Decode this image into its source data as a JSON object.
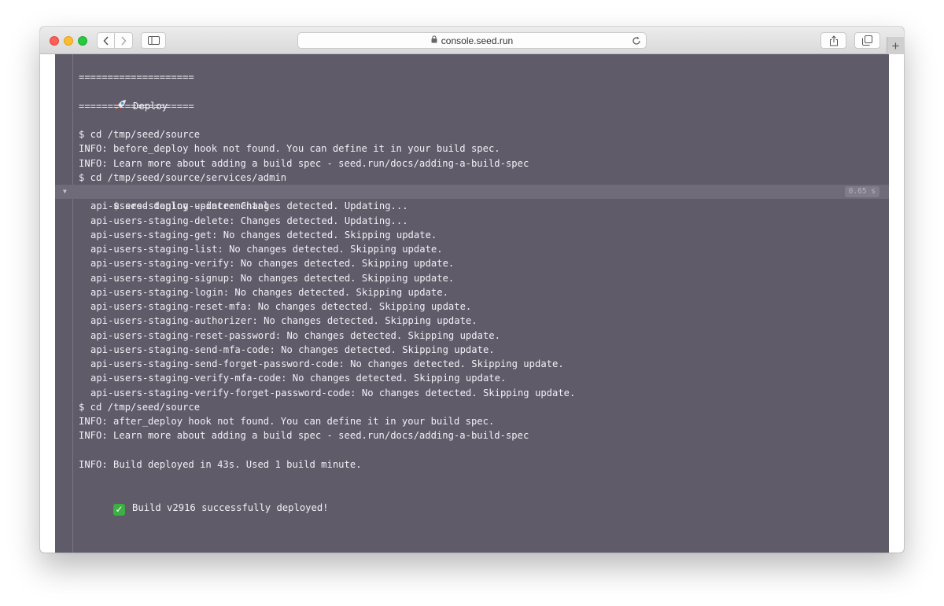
{
  "browser": {
    "url": "console.seed.run",
    "back_icon": "chevron-left-icon",
    "forward_icon": "chevron-right-icon",
    "sidebar_icon": "sidebar-icon",
    "share_icon": "share-icon",
    "tabs_icon": "tabs-icon",
    "reload_icon": "reload-icon",
    "lock_icon": "lock-icon",
    "newtab_label": "+"
  },
  "log": {
    "deploy_header": {
      "rule": "====================",
      "title": "Deploy",
      "icon": "rocket-icon"
    },
    "pre_lines": [
      "$ cd /tmp/seed/source",
      "INFO: before_deploy hook not found. You can define it in your build spec.",
      "INFO: Learn more about adding a build spec - seed.run/docs/adding-a-build-spec",
      "$ cd /tmp/seed/source/services/admin"
    ],
    "command": {
      "text": "$ seed deploy --incremental",
      "duration": "0.65 s",
      "caret_icon": "caret-down-icon"
    },
    "output_lines": [
      "api-users-staging-update: Changes detected. Updating...",
      "api-users-staging-delete: Changes detected. Updating...",
      "api-users-staging-get: No changes detected. Skipping update.",
      "api-users-staging-list: No changes detected. Skipping update.",
      "api-users-staging-verify: No changes detected. Skipping update.",
      "api-users-staging-signup: No changes detected. Skipping update.",
      "api-users-staging-login: No changes detected. Skipping update.",
      "api-users-staging-reset-mfa: No changes detected. Skipping update.",
      "api-users-staging-authorizer: No changes detected. Skipping update.",
      "api-users-staging-reset-password: No changes detected. Skipping update.",
      "api-users-staging-send-mfa-code: No changes detected. Skipping update.",
      "api-users-staging-send-forget-password-code: No changes detected. Skipping update.",
      "api-users-staging-verify-mfa-code: No changes detected. Skipping update.",
      "api-users-staging-verify-forget-password-code: No changes detected. Skipping update."
    ],
    "post_lines": [
      "$ cd /tmp/seed/source",
      "INFO: after_deploy hook not found. You can define it in your build spec.",
      "INFO: Learn more about adding a build spec - seed.run/docs/adding-a-build-spec"
    ],
    "summary": "INFO: Build deployed in 43s. Used 1 build minute.",
    "success": {
      "icon": "check-mark-icon",
      "text": "Build v2916 successfully deployed!"
    }
  }
}
